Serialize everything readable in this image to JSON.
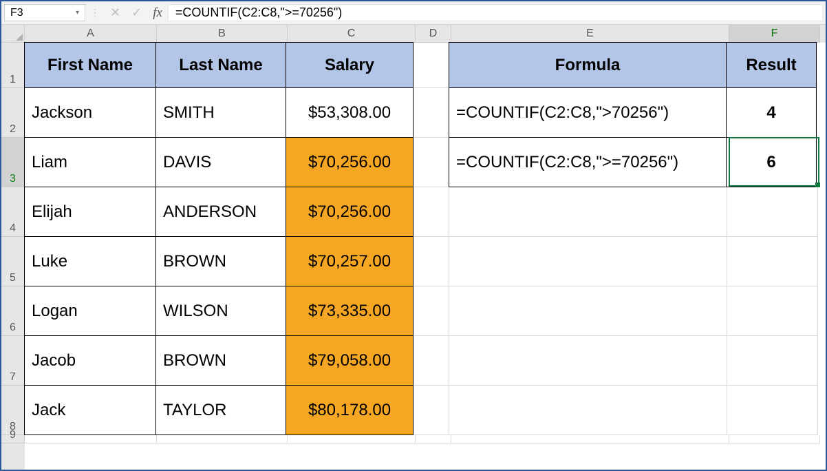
{
  "namebox": "F3",
  "formula_bar": "=COUNTIF(C2:C8,\">=70256\")",
  "icons": {
    "cancel": "✕",
    "enter": "✓",
    "fx": "fx",
    "dropdown": "▾",
    "divider": "⋮"
  },
  "columns": [
    "A",
    "B",
    "C",
    "D",
    "E",
    "F"
  ],
  "col_widths": [
    "wA",
    "wB",
    "wC",
    "wD",
    "wE",
    "wF"
  ],
  "rows": [
    "1",
    "2",
    "3",
    "4",
    "5",
    "6",
    "7",
    "8",
    "9"
  ],
  "row_heights": [
    "h1",
    "hN",
    "hN",
    "hN",
    "hN",
    "hN",
    "hN",
    "hN",
    "h9"
  ],
  "selected": {
    "col_index": 5,
    "row_index": 2
  },
  "headers": {
    "A": "First Name",
    "B": "Last Name",
    "C": "Salary",
    "E": "Formula",
    "F": "Result"
  },
  "people": [
    {
      "first": "Jackson",
      "last": "SMITH",
      "salary": "$53,308.00",
      "hl": false
    },
    {
      "first": "Liam",
      "last": "DAVIS",
      "salary": "$70,256.00",
      "hl": true
    },
    {
      "first": "Elijah",
      "last": "ANDERSON",
      "salary": "$70,256.00",
      "hl": true
    },
    {
      "first": "Luke",
      "last": "BROWN",
      "salary": "$70,257.00",
      "hl": true
    },
    {
      "first": "Logan",
      "last": "WILSON",
      "salary": "$73,335.00",
      "hl": true
    },
    {
      "first": "Jacob",
      "last": "BROWN",
      "salary": "$79,058.00",
      "hl": true
    },
    {
      "first": "Jack",
      "last": "TAYLOR",
      "salary": "$80,178.00",
      "hl": true
    }
  ],
  "formulas": [
    {
      "text": "=COUNTIF(C2:C8,\">70256\")",
      "result": "4"
    },
    {
      "text": "=COUNTIF(C2:C8,\">=70256\")",
      "result": "6"
    }
  ],
  "chart_data": {
    "type": "table",
    "columns": [
      "First Name",
      "Last Name",
      "Salary"
    ],
    "rows": [
      [
        "Jackson",
        "SMITH",
        53308.0
      ],
      [
        "Liam",
        "DAVIS",
        70256.0
      ],
      [
        "Elijah",
        "ANDERSON",
        70256.0
      ],
      [
        "Luke",
        "BROWN",
        70257.0
      ],
      [
        "Logan",
        "WILSON",
        73335.0
      ],
      [
        "Jacob",
        "BROWN",
        79058.0
      ],
      [
        "Jack",
        "TAYLOR",
        80178.0
      ]
    ],
    "side_table": {
      "columns": [
        "Formula",
        "Result"
      ],
      "rows": [
        [
          "=COUNTIF(C2:C8,\">70256\")",
          4
        ],
        [
          "=COUNTIF(C2:C8,\">=70256\")",
          6
        ]
      ]
    }
  }
}
